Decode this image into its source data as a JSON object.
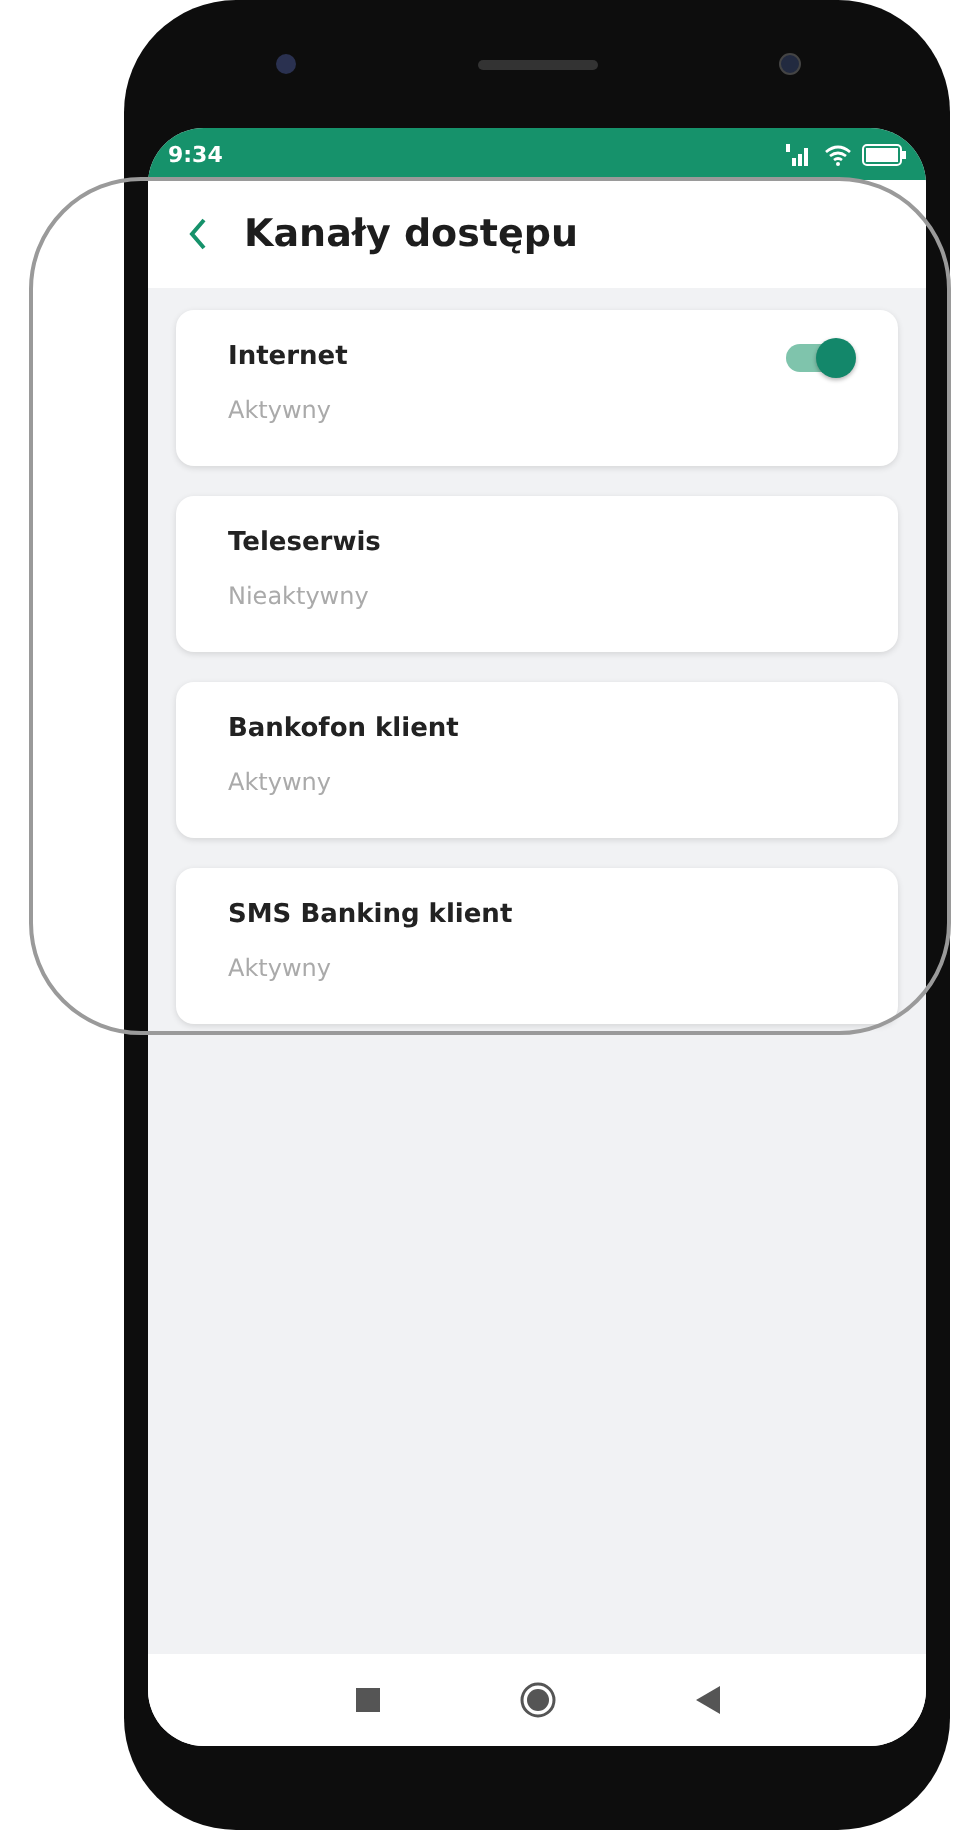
{
  "status_bar": {
    "time": "9:34"
  },
  "header": {
    "title": "Kanały dostępu"
  },
  "channels": [
    {
      "name": "Internet",
      "status": "Aktywny",
      "kind": "toggle",
      "on": true
    },
    {
      "name": "Teleserwis",
      "status": "Nieaktywny",
      "kind": "plain"
    },
    {
      "name": "Bankofon klient",
      "status": "Aktywny",
      "kind": "plain"
    },
    {
      "name": "SMS Banking klient",
      "status": "Aktywny",
      "kind": "plain"
    }
  ]
}
